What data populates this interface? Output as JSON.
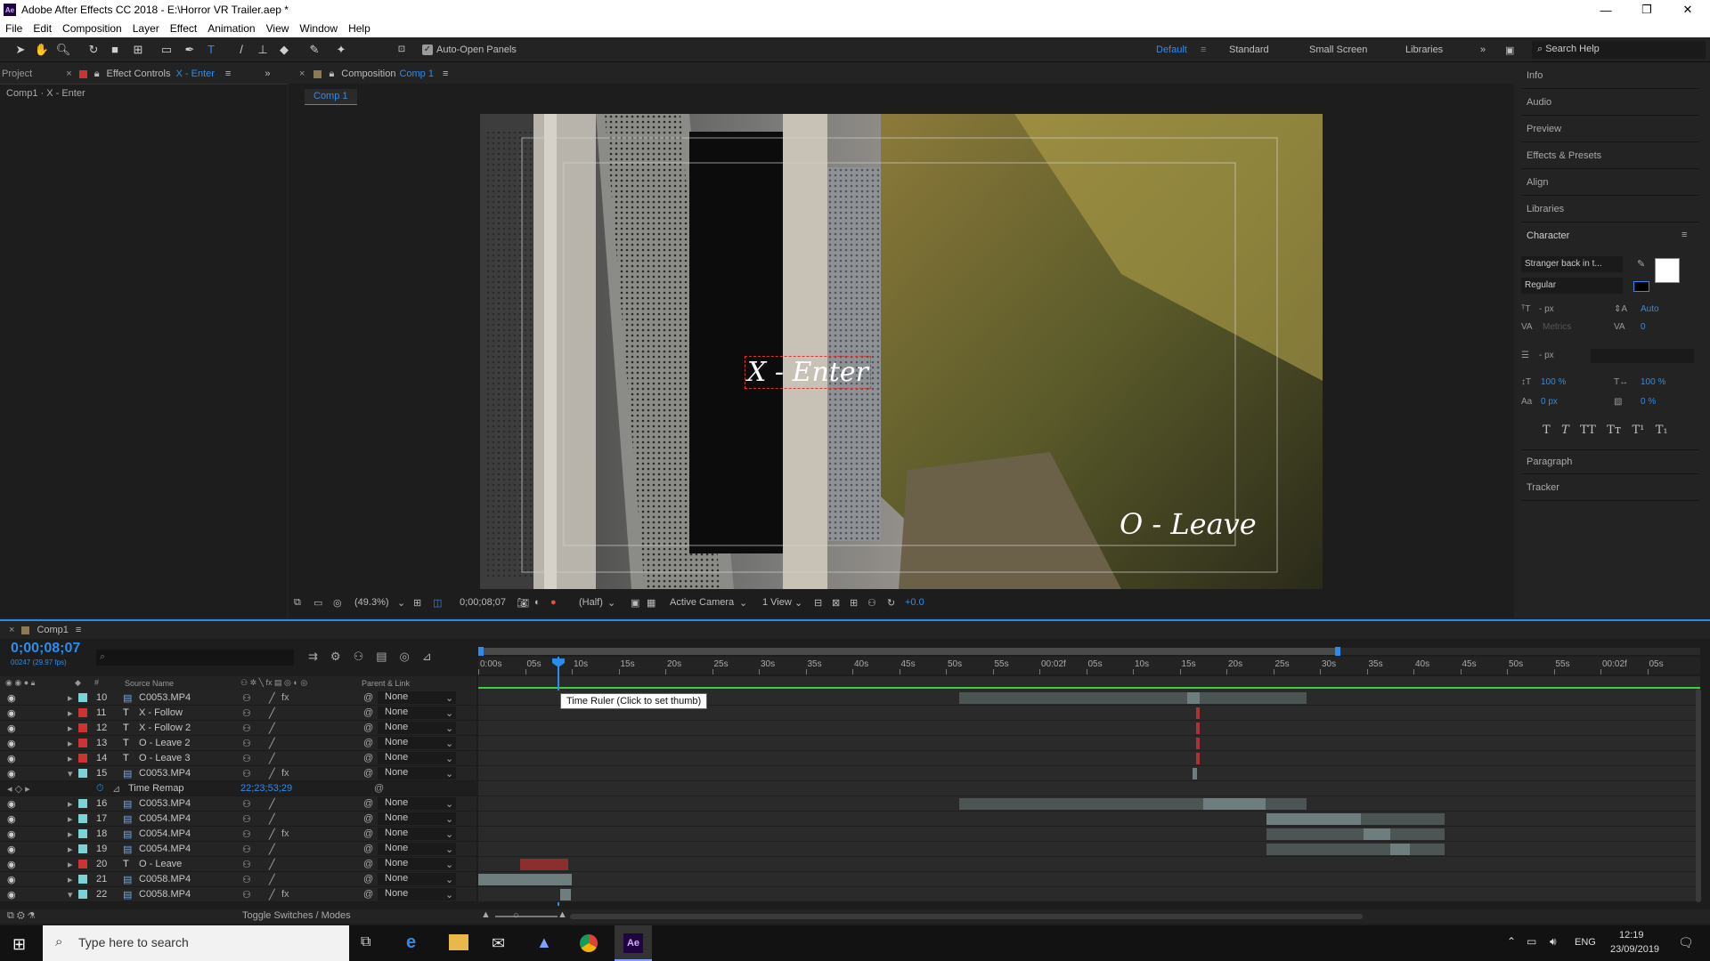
{
  "window": {
    "title": "Adobe After Effects CC 2018 - E:\\Horror VR Trailer.aep *",
    "app_icon": "Ae",
    "minimize": "—",
    "restore": "❐",
    "close": "✕"
  },
  "menu": [
    "File",
    "Edit",
    "Composition",
    "Layer",
    "Effect",
    "Animation",
    "View",
    "Window",
    "Help"
  ],
  "toolbar": {
    "auto_open": "Auto-Open Panels",
    "workspaces": [
      "Default",
      "Standard",
      "Small Screen",
      "Libraries"
    ],
    "search_help": "Search Help"
  },
  "left_panel": {
    "tab_project": "Project",
    "tab_effect_controls": "Effect Controls",
    "effect_layer": "X - Enter",
    "breadcrumb": "Comp1 · X - Enter"
  },
  "comp_panel": {
    "tab_label": "Composition",
    "comp_name": "Comp 1",
    "sub_tab": "Comp 1",
    "zoom": "(49.3%)",
    "timecode": "0;00;08;07",
    "resolution": "(Half)",
    "camera": "Active Camera",
    "views": "1 View",
    "exposure": "+0.0"
  },
  "overlay_text": {
    "x_enter": "X - Enter",
    "o_leave": "O - Leave"
  },
  "right_panel": {
    "items": [
      "Info",
      "Audio",
      "Preview",
      "Effects & Presets",
      "Align",
      "Libraries"
    ],
    "character": {
      "title": "Character",
      "font": "Stranger back in t...",
      "style": "Regular",
      "size": "- px",
      "leading": "Auto",
      "kerning": "Metrics",
      "tracking": "0",
      "line": "- px",
      "vscale": "100 %",
      "hscale": "100 %",
      "baseline": "0 px",
      "tsume": "0 %",
      "styles": [
        "T",
        "T",
        "TT",
        "Tт",
        "T¹",
        "T₁"
      ]
    },
    "paragraph": "Paragraph",
    "tracker": "Tracker"
  },
  "timeline": {
    "tab": "Comp1",
    "timecode": "0;00;08;07",
    "fps": "00247 (29.97 fps)",
    "col_source": "Source Name",
    "col_num": "#",
    "col_parent": "Parent & Link",
    "toggle": "Toggle Switches / Modes",
    "tooltip": "Time Ruler (Click to set thumb)",
    "ruler": [
      "0:00s",
      "05s",
      "10s",
      "15s",
      "20s",
      "25s",
      "30s",
      "35s",
      "40s",
      "45s",
      "50s",
      "55s",
      "00:02f",
      "05s",
      "10s",
      "15s",
      "20s",
      "25s",
      "30s",
      "35s",
      "40s",
      "45s",
      "50s",
      "55s",
      "00:02f",
      "05s"
    ],
    "layers": [
      {
        "num": "10",
        "type": "F",
        "name": "C0053.MP4",
        "color": "#7bd3d6",
        "fx": true,
        "parent": "None"
      },
      {
        "num": "11",
        "type": "T",
        "name": "X - Follow",
        "color": "#c33",
        "fx": false,
        "parent": "None"
      },
      {
        "num": "12",
        "type": "T",
        "name": "X - Follow 2",
        "color": "#c33",
        "fx": false,
        "parent": "None"
      },
      {
        "num": "13",
        "type": "T",
        "name": "O - Leave 2",
        "color": "#c33",
        "fx": false,
        "parent": "None"
      },
      {
        "num": "14",
        "type": "T",
        "name": "O - Leave 3",
        "color": "#c33",
        "fx": false,
        "parent": "None"
      },
      {
        "num": "15",
        "type": "F",
        "name": "C0053.MP4",
        "color": "#7bd3d6",
        "fx": true,
        "parent": "None"
      },
      {
        "num": "",
        "type": "",
        "name": "Time Remap",
        "color": "",
        "fx": false,
        "parent": "",
        "value": "22;23;53;29"
      },
      {
        "num": "16",
        "type": "F",
        "name": "C0053.MP4",
        "color": "#7bd3d6",
        "fx": false,
        "parent": "None"
      },
      {
        "num": "17",
        "type": "F",
        "name": "C0054.MP4",
        "color": "#7bd3d6",
        "fx": false,
        "parent": "None"
      },
      {
        "num": "18",
        "type": "F",
        "name": "C0054.MP4",
        "color": "#7bd3d6",
        "fx": true,
        "parent": "None"
      },
      {
        "num": "19",
        "type": "F",
        "name": "C0054.MP4",
        "color": "#7bd3d6",
        "fx": false,
        "parent": "None"
      },
      {
        "num": "20",
        "type": "T",
        "name": "O - Leave",
        "color": "#c33",
        "fx": false,
        "parent": "None"
      },
      {
        "num": "21",
        "type": "F",
        "name": "C0058.MP4",
        "color": "#7bd3d6",
        "fx": false,
        "parent": "None"
      },
      {
        "num": "22",
        "type": "F",
        "name": "C0058.MP4",
        "color": "#7bd3d6",
        "fx": true,
        "parent": "None"
      }
    ]
  },
  "taskbar": {
    "search": "Type here to search",
    "lang": "ENG",
    "time": "12:19",
    "date": "23/09/2019"
  }
}
